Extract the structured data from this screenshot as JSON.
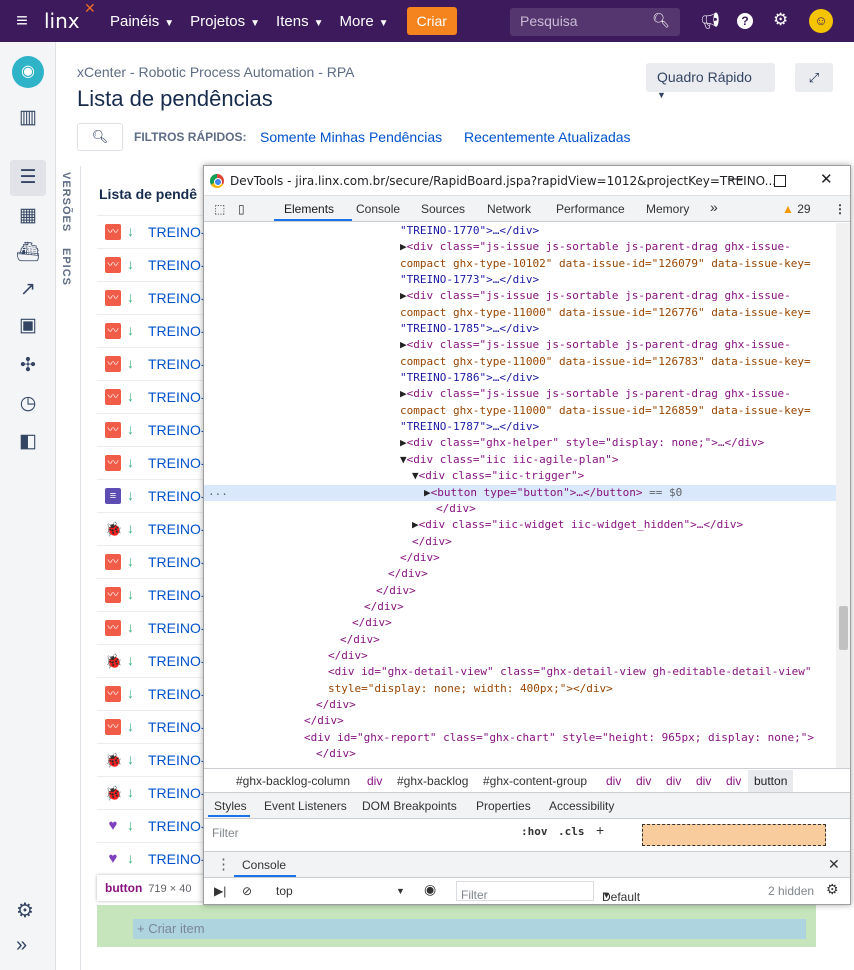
{
  "topnav": {
    "logo": "linx",
    "items": [
      {
        "label": "Painéis"
      },
      {
        "label": "Projetos"
      },
      {
        "label": "Itens"
      },
      {
        "label": "More"
      }
    ],
    "create_label": "Criar",
    "search_placeholder": "Pesquisa"
  },
  "header": {
    "breadcrumb": "xCenter - Robotic Process Automation - RPA",
    "title": "Lista de pendências",
    "quick_button": "Quadro Rápido",
    "filters_label": "FILTROS RÁPIDOS:",
    "filter_1": "Somente Minhas Pendências",
    "filter_2": "Recentemente Atualizadas"
  },
  "board": {
    "tab_versions": "VERSÕES",
    "tab_epics": "EPICS",
    "title": "Lista de pendê",
    "rows": [
      {
        "type": "bug-report",
        "key": "TREINO-"
      },
      {
        "type": "bug-report",
        "key": "TREINO-"
      },
      {
        "type": "bug-report",
        "key": "TREINO-"
      },
      {
        "type": "bug-report",
        "key": "TREINO-"
      },
      {
        "type": "bug-report",
        "key": "TREINO-"
      },
      {
        "type": "bug-report",
        "key": "TREINO-"
      },
      {
        "type": "bug-report",
        "key": "TREINO-"
      },
      {
        "type": "bug-report",
        "key": "TREINO-"
      },
      {
        "type": "story",
        "key": "TREINO-"
      },
      {
        "type": "ladybug",
        "key": "TREINO-"
      },
      {
        "type": "bug-report",
        "key": "TREINO-"
      },
      {
        "type": "bug-report",
        "key": "TREINO-"
      },
      {
        "type": "bug-report",
        "key": "TREINO-"
      },
      {
        "type": "ladybug",
        "key": "TREINO-"
      },
      {
        "type": "bug-report",
        "key": "TREINO-"
      },
      {
        "type": "bug-report",
        "key": "TREINO-"
      },
      {
        "type": "ladybug",
        "key": "TREINO-"
      },
      {
        "type": "ladybug",
        "key": "TREINO-"
      },
      {
        "type": "heart",
        "key": "TREINO-"
      },
      {
        "type": "heart",
        "key": "TREINO-"
      }
    ],
    "create_item": "+ Criar item",
    "tooltip_tag": "button",
    "tooltip_dim": "719 × 40"
  },
  "devtools": {
    "title": "DevTools - jira.linx.com.br/secure/RapidBoard.jspa?rapidView=1012&projectKey=TREINO...",
    "tabs": [
      "Elements",
      "Console",
      "Sources",
      "Network",
      "Performance",
      "Memory"
    ],
    "more_tabs": "»",
    "warnings": "29",
    "code": {
      "l0": "\"TREINO-1770\">…</div>",
      "l1a": "<div class=\"js-issue js-sortable js-parent-drag ghx-issue-",
      "l1b": "compact ghx-type-10102\" data-issue-id=\"126079\" data-issue-key=",
      "l1c": "\"TREINO-1773\">…</div>",
      "l2a": "<div class=\"js-issue js-sortable js-parent-drag ghx-issue-",
      "l2b": "compact ghx-type-11000\" data-issue-id=\"126776\" data-issue-key=",
      "l2c": "\"TREINO-1785\">…</div>",
      "l3a": "<div class=\"js-issue js-sortable js-parent-drag ghx-issue-",
      "l3b": "compact ghx-type-11000\" data-issue-id=\"126783\" data-issue-key=",
      "l3c": "\"TREINO-1786\">…</div>",
      "l4a": "<div class=\"js-issue js-sortable js-parent-drag ghx-issue-",
      "l4b": "compact ghx-type-11000\" data-issue-id=\"126859\" data-issue-key=",
      "l4c": "\"TREINO-1787\">…</div>",
      "l5": "<div class=\"ghx-helper\" style=\"display: none;\">…</div>",
      "l6": "<div class=\"iic iic-agile-plan\">",
      "l7": "<div class=\"iic-trigger\">",
      "l8": "<button type=\"button\">…</button>",
      "l8eq": "== $0",
      "l9": "</div>",
      "l10": "<div class=\"iic-widget iic-widget_hidden\">…</div>",
      "l11": "</div>",
      "l12": "</div>",
      "l13": "</div>",
      "l14": "</div>",
      "l15": "</div>",
      "l16": "</div>",
      "l17": "</div>",
      "l18": "</div>",
      "l19": "</div>",
      "l20a": "<div id=\"ghx-detail-view\" class=\"ghx-detail-view gh-editable-detail-view\"",
      "l20b": "style=\"display: none; width: 400px;\"></div>",
      "l21": "</div>",
      "l22": "</div>",
      "l23": "<div id=\"ghx-report\" class=\"ghx-chart\" style=\"height: 965px; display: none;\">",
      "l24": "</div>",
      "gutter": "···"
    },
    "crumbs": [
      "#ghx-backlog-column",
      "div",
      "#ghx-backlog",
      "#ghx-content-group",
      "div",
      "div",
      "div",
      "div",
      "div",
      "button"
    ],
    "styles_tabs": [
      "Styles",
      "Event Listeners",
      "DOM Breakpoints",
      "Properties",
      "Accessibility"
    ],
    "filter_placeholder": "Filter",
    "hov": ":hov",
    "cls": ".cls",
    "drawer_label": "Console",
    "context": "top",
    "console_filter": "Filter",
    "levels": "Default levels",
    "hidden": "2 hidden"
  }
}
